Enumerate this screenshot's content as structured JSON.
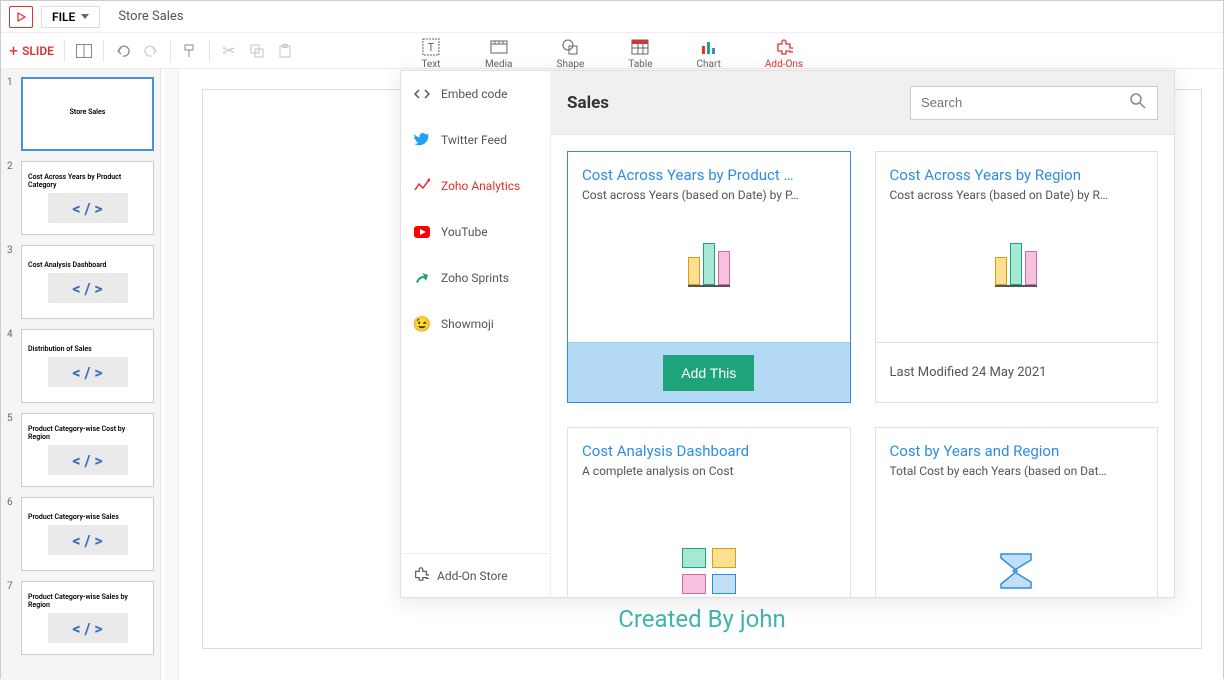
{
  "header": {
    "file_label": "FILE",
    "doc_title": "Store Sales"
  },
  "toolbar": {
    "add_slide": "SLIDE",
    "tools": [
      {
        "id": "text",
        "label": "Text"
      },
      {
        "id": "media",
        "label": "Media"
      },
      {
        "id": "shape",
        "label": "Shape"
      },
      {
        "id": "table",
        "label": "Table"
      },
      {
        "id": "chart",
        "label": "Chart"
      },
      {
        "id": "addons",
        "label": "Add-Ons"
      }
    ]
  },
  "slides": [
    {
      "num": "1",
      "title": "Store Sales",
      "center": true,
      "embed": false,
      "selected": true
    },
    {
      "num": "2",
      "title": "Cost Across Years by Product Category",
      "embed": true
    },
    {
      "num": "3",
      "title": "Cost Analysis Dashboard",
      "embed": true
    },
    {
      "num": "4",
      "title": "Distribution of Sales",
      "embed": true
    },
    {
      "num": "5",
      "title": "Product Category-wise Cost by Region",
      "embed": true
    },
    {
      "num": "6",
      "title": "Product Category-wise Sales",
      "embed": true
    },
    {
      "num": "7",
      "title": "Product Category-wise Sales by Region",
      "embed": true
    }
  ],
  "canvas": {
    "created_by": "Created By john"
  },
  "addons_panel": {
    "sources": [
      {
        "id": "embed",
        "label": "Embed code"
      },
      {
        "id": "twitter",
        "label": "Twitter Feed"
      },
      {
        "id": "zoho-analytics",
        "label": "Zoho Analytics",
        "active": true
      },
      {
        "id": "youtube",
        "label": "YouTube"
      },
      {
        "id": "zoho-sprints",
        "label": "Zoho Sprints"
      },
      {
        "id": "showmoji",
        "label": "Showmoji"
      }
    ],
    "store_label": "Add-On Store",
    "content_title": "Sales",
    "search_placeholder": "Search",
    "cards": [
      {
        "title": "Cost Across Years by Product …",
        "subtitle": "Cost across Years (based on Date) by P…",
        "graphic": "bars",
        "footer": "add",
        "add_label": "Add This",
        "selected": true
      },
      {
        "title": "Cost Across Years by Region",
        "subtitle": "Cost across Years (based on Date) by R…",
        "graphic": "bars",
        "footer": "modified",
        "modified": "Last Modified 24 May 2021"
      },
      {
        "title": "Cost Analysis Dashboard",
        "subtitle": "A complete analysis on Cost",
        "graphic": "dashboard",
        "footer": "none"
      },
      {
        "title": "Cost by Years and Region",
        "subtitle": "Total Cost by each Years (based on Dat…",
        "graphic": "sigma",
        "footer": "none"
      }
    ]
  }
}
